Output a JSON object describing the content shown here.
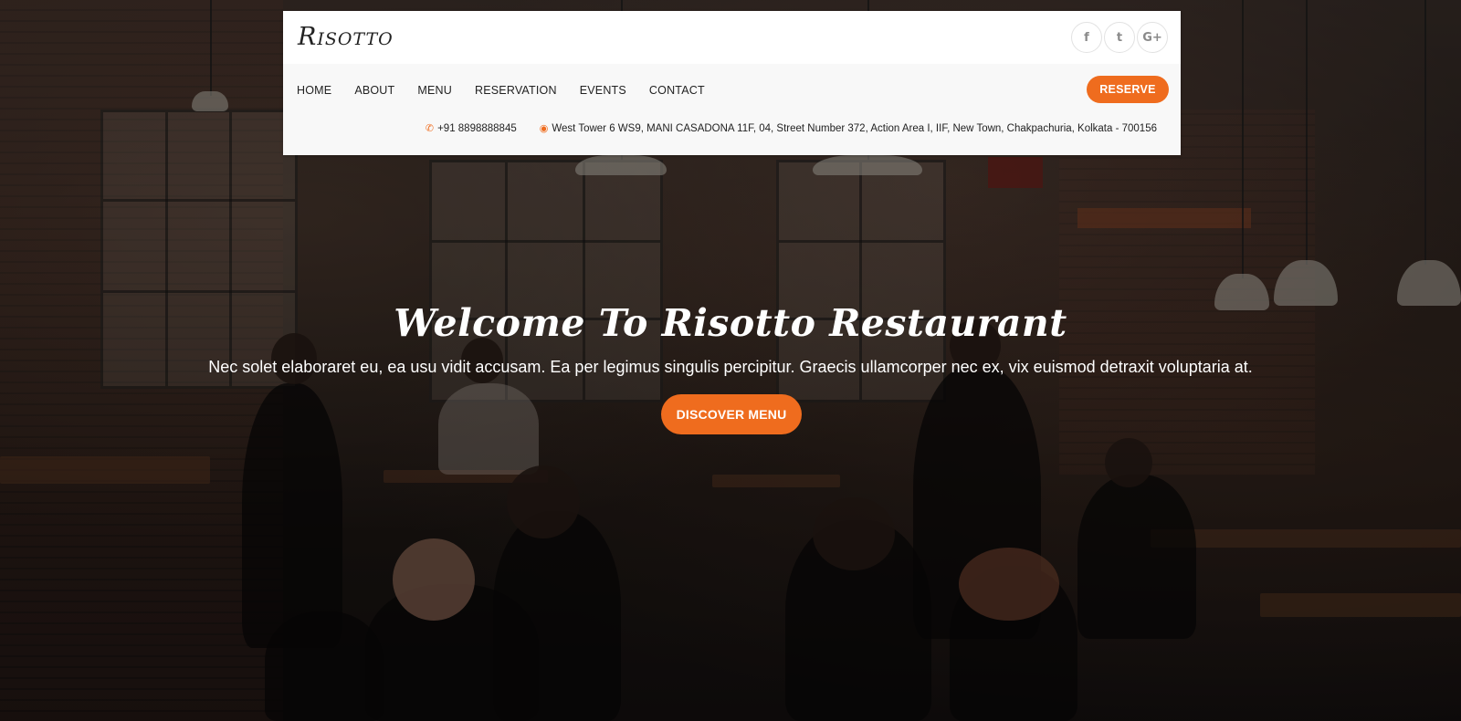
{
  "colors": {
    "accent": "#ef6c1e",
    "header_bg": "#ffffff",
    "nav_bg": "#f8f8f8",
    "text_dark": "#222222",
    "hero_text": "#ffffff"
  },
  "header": {
    "logo": "Risotto",
    "socials": [
      {
        "icon": "facebook-icon",
        "glyph": "f"
      },
      {
        "icon": "twitter-icon",
        "glyph": "t"
      },
      {
        "icon": "google-plus-icon",
        "glyph": "G+"
      }
    ],
    "nav": [
      "HOME",
      "ABOUT",
      "MENU",
      "RESERVATION",
      "EVENTS",
      "CONTACT"
    ],
    "reserve_label": "RESERVE",
    "phone_icon": "phone-icon",
    "phone": "+91 8898888845",
    "address_icon": "map-marker-icon",
    "address": "West Tower 6 WS9, MANI CASADONA 11F, 04, Street Number 372, Action Area I, IIF, New Town, Chakpachuria, Kolkata - 700156"
  },
  "hero": {
    "title": "Welcome To Risotto Restaurant",
    "subtitle": "Nec solet elaboraret eu, ea usu vidit accusam. Ea per legimus singulis percipitur. Graecis ullamcorper nec ex, vix euismod detraxit voluptaria at.",
    "cta_label": "DISCOVER MENU"
  }
}
